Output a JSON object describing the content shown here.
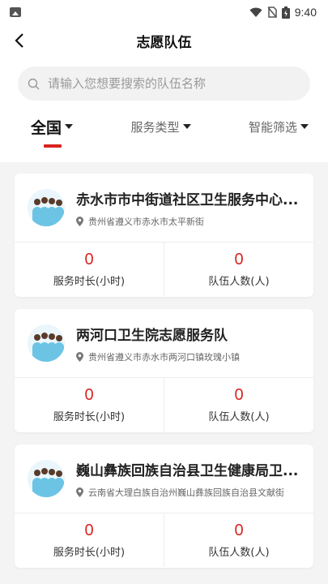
{
  "status": {
    "time": "9:40"
  },
  "header": {
    "title": "志愿队伍"
  },
  "search": {
    "placeholder": "请输入您想要搜索的队伍名称"
  },
  "filters": [
    {
      "label": "全国",
      "active": true
    },
    {
      "label": "服务类型",
      "active": false
    },
    {
      "label": "智能筛选",
      "active": false
    }
  ],
  "colors": {
    "accent": "#d9241f",
    "bg": "#f4f4f4"
  },
  "teams": [
    {
      "name": "赤水市市中街道社区卫生服务中心...",
      "address": "贵州省遵义市赤水市太平新街",
      "hours_value": "0",
      "hours_label": "服务时长(小时)",
      "members_value": "0",
      "members_label": "队伍人数(人)"
    },
    {
      "name": "两河口卫生院志愿服务队",
      "address": "贵州省遵义市赤水市两河口镇玫瑰小镇",
      "hours_value": "0",
      "hours_label": "服务时长(小时)",
      "members_value": "0",
      "members_label": "队伍人数(人)"
    },
    {
      "name": "巍山彝族回族自治县卫生健康局卫...",
      "address": "云南省大理白族自治州巍山彝族回族自治县文献街",
      "hours_value": "0",
      "hours_label": "服务时长(小时)",
      "members_value": "0",
      "members_label": "队伍人数(人)"
    }
  ]
}
